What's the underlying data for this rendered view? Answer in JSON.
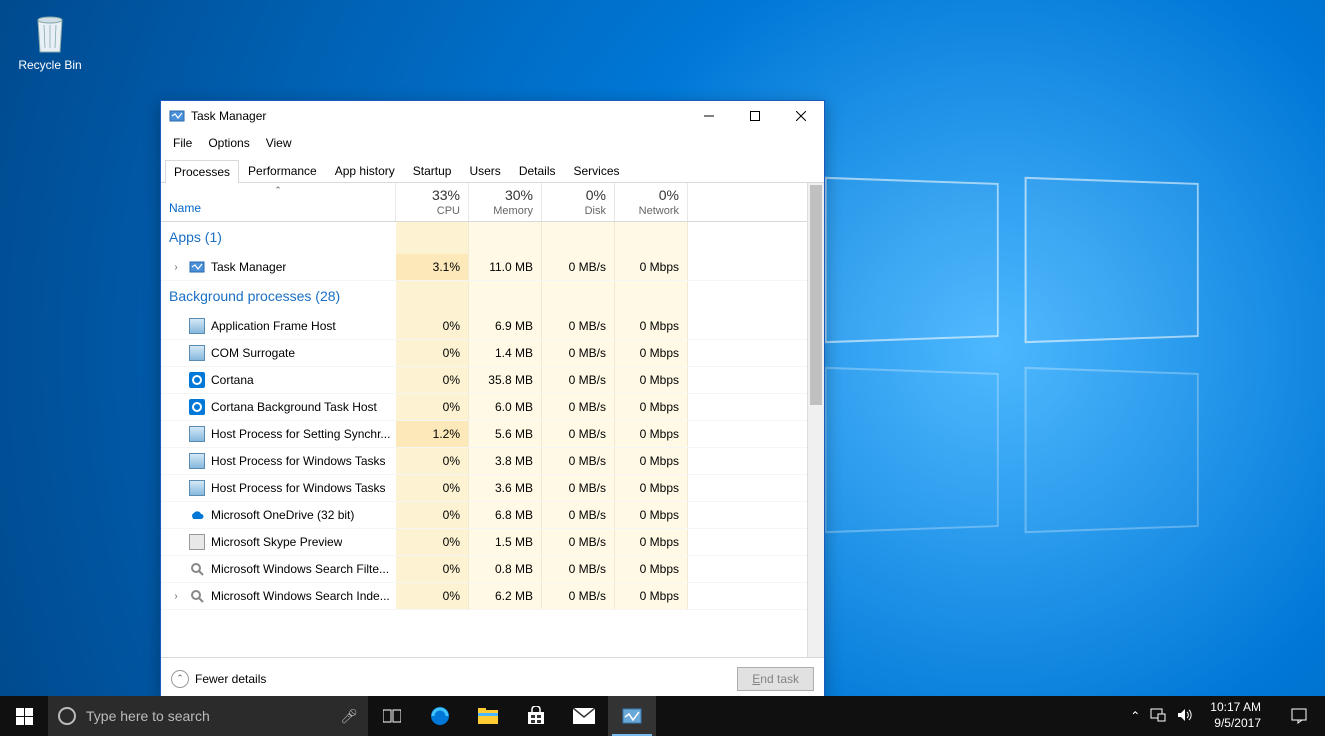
{
  "desktop": {
    "recycle_bin": "Recycle Bin"
  },
  "window": {
    "title": "Task Manager",
    "menu": [
      "File",
      "Options",
      "View"
    ],
    "tabs": [
      "Processes",
      "Performance",
      "App history",
      "Startup",
      "Users",
      "Details",
      "Services"
    ],
    "active_tab": 0,
    "columns": {
      "name": "Name",
      "cpu": {
        "pct": "33%",
        "label": "CPU"
      },
      "memory": {
        "pct": "30%",
        "label": "Memory"
      },
      "disk": {
        "pct": "0%",
        "label": "Disk"
      },
      "network": {
        "pct": "0%",
        "label": "Network"
      }
    },
    "groups": [
      {
        "title": "Apps (1)",
        "rows": [
          {
            "expand": true,
            "icon": "taskmgr",
            "name": "Task Manager",
            "cpu": "3.1%",
            "memory": "11.0 MB",
            "disk": "0 MB/s",
            "network": "0 Mbps",
            "hot": true
          }
        ]
      },
      {
        "title": "Background processes (28)",
        "rows": [
          {
            "icon": "exe",
            "name": "Application Frame Host",
            "cpu": "0%",
            "memory": "6.9 MB",
            "disk": "0 MB/s",
            "network": "0 Mbps"
          },
          {
            "icon": "exe",
            "name": "COM Surrogate",
            "cpu": "0%",
            "memory": "1.4 MB",
            "disk": "0 MB/s",
            "network": "0 Mbps"
          },
          {
            "icon": "cortana",
            "name": "Cortana",
            "cpu": "0%",
            "memory": "35.8 MB",
            "disk": "0 MB/s",
            "network": "0 Mbps"
          },
          {
            "icon": "cortana",
            "name": "Cortana Background Task Host",
            "cpu": "0%",
            "memory": "6.0 MB",
            "disk": "0 MB/s",
            "network": "0 Mbps"
          },
          {
            "icon": "exe",
            "name": "Host Process for Setting Synchr...",
            "cpu": "1.2%",
            "memory": "5.6 MB",
            "disk": "0 MB/s",
            "network": "0 Mbps",
            "hot": true
          },
          {
            "icon": "exe",
            "name": "Host Process for Windows Tasks",
            "cpu": "0%",
            "memory": "3.8 MB",
            "disk": "0 MB/s",
            "network": "0 Mbps"
          },
          {
            "icon": "exe",
            "name": "Host Process for Windows Tasks",
            "cpu": "0%",
            "memory": "3.6 MB",
            "disk": "0 MB/s",
            "network": "0 Mbps"
          },
          {
            "icon": "cloud",
            "name": "Microsoft OneDrive (32 bit)",
            "cpu": "0%",
            "memory": "6.8 MB",
            "disk": "0 MB/s",
            "network": "0 Mbps"
          },
          {
            "icon": "generic",
            "name": "Microsoft Skype Preview",
            "cpu": "0%",
            "memory": "1.5 MB",
            "disk": "0 MB/s",
            "network": "0 Mbps"
          },
          {
            "icon": "search",
            "name": "Microsoft Windows Search Filte...",
            "cpu": "0%",
            "memory": "0.8 MB",
            "disk": "0 MB/s",
            "network": "0 Mbps"
          },
          {
            "expand": true,
            "icon": "search",
            "name": "Microsoft Windows Search Inde...",
            "cpu": "0%",
            "memory": "6.2 MB",
            "disk": "0 MB/s",
            "network": "0 Mbps"
          }
        ]
      }
    ],
    "fewer_details": "Fewer details",
    "end_task": "End task"
  },
  "taskbar": {
    "search_placeholder": "Type here to search",
    "time": "10:17 AM",
    "date": "9/5/2017"
  }
}
